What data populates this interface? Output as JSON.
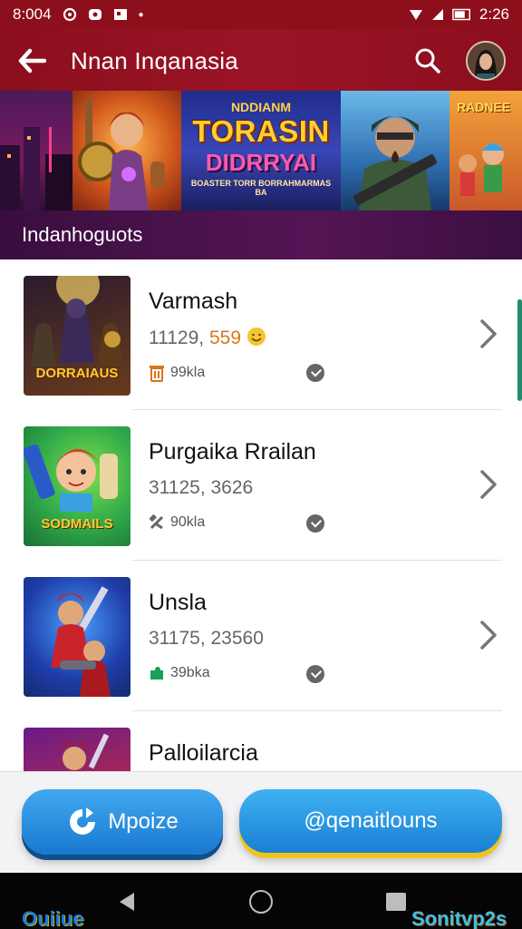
{
  "status_bar": {
    "time": "8:004",
    "battery_text": "2:26"
  },
  "app_bar": {
    "title": "Nnan Inqanasia"
  },
  "banner": {
    "logo_top": "NDDIANM",
    "logo_main": "TORASIN",
    "logo_sub": "DIDRRYAI",
    "logo_tag": "BOASTER TORR BORRAHMARMAS BA",
    "tile4_logo": "RADNEE"
  },
  "section": {
    "title": "Indanhoguots"
  },
  "games": [
    {
      "name": "Varmash",
      "stat_main": "11129,",
      "stat_highlight": "559",
      "meta": "99kla",
      "thumb_logo": "DORRAIAUS",
      "thumb_colors": [
        "#2a1b2e",
        "#6a3b1c"
      ]
    },
    {
      "name": "Purgaika Rrailan",
      "stat_main": "31125, 3626",
      "stat_highlight": "",
      "meta": "90kla",
      "thumb_logo": "SODMAILS",
      "thumb_colors": [
        "#2fa84a",
        "#1b6e34"
      ]
    },
    {
      "name": "Unsla",
      "stat_main": "31175, 23560",
      "stat_highlight": "",
      "meta": "39bka",
      "thumb_logo": "",
      "thumb_colors": [
        "#1f3da8",
        "#c8242a"
      ]
    },
    {
      "name": "Palloilarcia",
      "stat_main": "",
      "stat_highlight": "",
      "meta": "",
      "thumb_logo": "",
      "thumb_colors": [
        "#6a1a8a",
        "#d8342a"
      ]
    }
  ],
  "actions": {
    "primary_label": "Mpoize",
    "secondary_label": "@qenaitlouns"
  },
  "nav_bar": {
    "logo_left": "Ouiiue",
    "logo_right": "Sonitvp2s"
  },
  "colors": {
    "app_bar": "#9b1426",
    "section_band": "#541555",
    "button_blue": "#1b7fd3",
    "button_accent": "#f0c419",
    "highlight_orange": "#d9751a"
  }
}
